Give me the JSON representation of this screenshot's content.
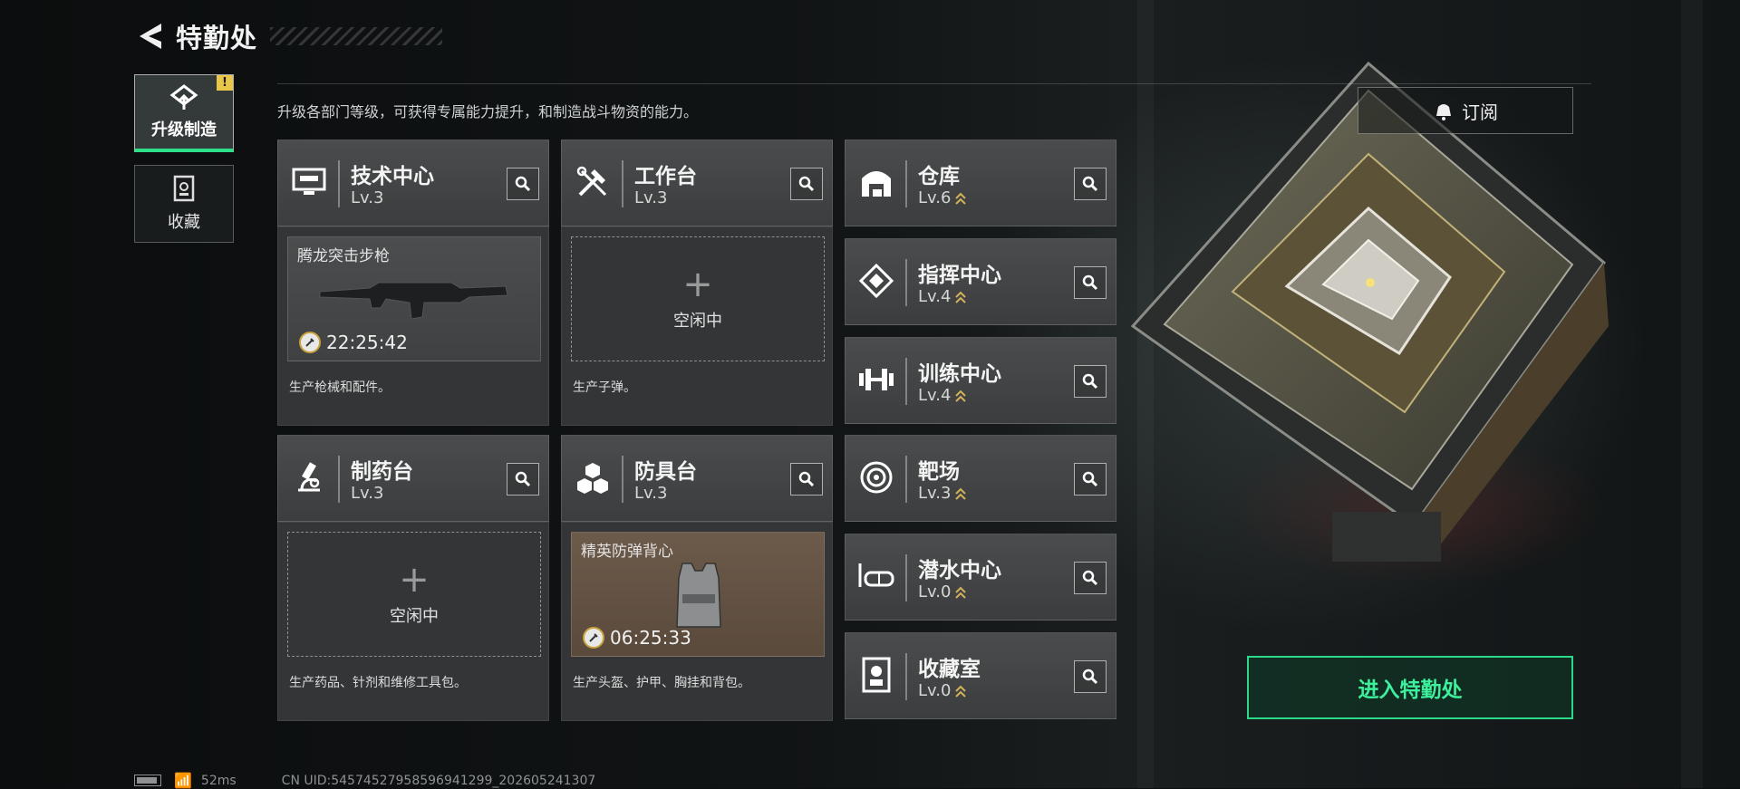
{
  "header": {
    "title": "特勤处"
  },
  "sidebar": {
    "tabs": [
      {
        "label": "升级制造",
        "active": true,
        "alert": "!"
      },
      {
        "label": "收藏",
        "active": false
      }
    ]
  },
  "description": "升级各部门等级，可获得专属能力提升，和制造战斗物资的能力。",
  "departments": {
    "tech_center": {
      "name": "技术中心",
      "level": "Lv.3",
      "icon": "monitor-icon",
      "slot": {
        "item": "腾龙突击步枪",
        "timer": "22:25:42"
      },
      "desc": "生产枪械和配件。"
    },
    "workbench": {
      "name": "工作台",
      "level": "Lv.3",
      "icon": "tools-icon",
      "slot": {
        "plus": "+",
        "idle": "空闲中"
      },
      "desc": "生产子弹。"
    },
    "pharmacy": {
      "name": "制药台",
      "level": "Lv.3",
      "icon": "microscope-icon",
      "slot": {
        "plus": "+",
        "idle": "空闲中"
      },
      "desc": "生产药品、针剂和维修工具包。"
    },
    "armor": {
      "name": "防具台",
      "level": "Lv.3",
      "icon": "blocks-icon",
      "slot": {
        "item": "精英防弹背心",
        "timer": "06:25:33"
      },
      "desc": "生产头盔、护甲、胸挂和背包。"
    },
    "warehouse": {
      "name": "仓库",
      "level": "Lv.6",
      "icon": "warehouse-icon"
    },
    "command": {
      "name": "指挥中心",
      "level": "Lv.4",
      "icon": "diamond-icon"
    },
    "training": {
      "name": "训练中心",
      "level": "Lv.4",
      "icon": "dumbbell-icon"
    },
    "range": {
      "name": "靶场",
      "level": "Lv.3",
      "icon": "target-icon"
    },
    "diving": {
      "name": "潜水中心",
      "level": "Lv.0",
      "icon": "goggles-icon"
    },
    "collection": {
      "name": "收藏室",
      "level": "Lv.0",
      "icon": "bust-icon"
    }
  },
  "right_panel": {
    "subscribe_label": "订阅",
    "enter_label": "进入特勤处"
  },
  "status_bar": {
    "ping": "52ms",
    "uid": "CN UID:54574527958596941299_202605241307"
  },
  "colors": {
    "accent": "#2bd98a",
    "warning": "#e9c64a",
    "level_up": "#d4b25a"
  }
}
